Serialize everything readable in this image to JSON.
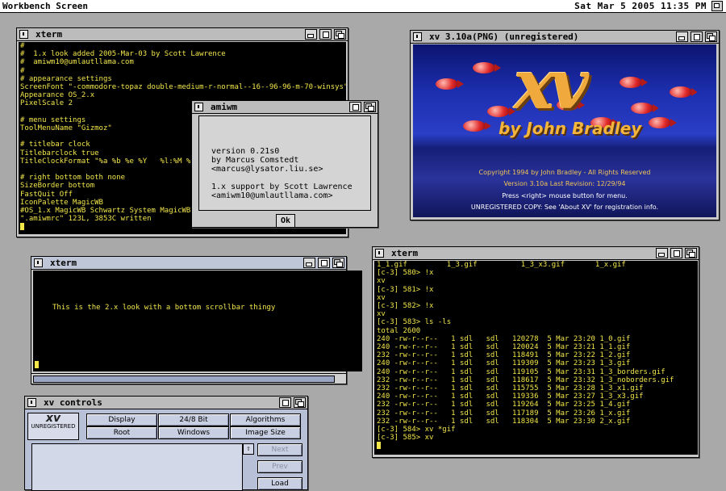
{
  "screen": {
    "title": "Workbench Screen",
    "clock": "Sat Mar  5 2005    11:35 PM"
  },
  "xterm1": {
    "title": "xterm",
    "lines": [
      "#",
      "#  1.x look added 2005-Mar-03 by Scott Lawrence",
      "#  amiwm10@umlautllama.com",
      "#",
      "# appearance settings",
      "ScreenFont \"-commodore-topaz double-medium-r-normal--16--96-96-m-70-winsys\"",
      "Appearance OS_2.x",
      "PixelScale 2",
      "",
      "# menu settings",
      "ToolMenuName \"Gizmoz\"",
      "",
      "# titlebar clock",
      "Titlebarclock true",
      "TitleClockFormat \"%a %b %e %Y   %l:%M %p\"",
      "",
      "# right bottom both none",
      "SizeBorder bottom",
      "FastQuit Off",
      "IconPalette MagicWB",
      "#OS_1.x MagicWB Schwartz System MagicWB",
      "\".amiwmrc\" 123L, 3853C written"
    ]
  },
  "amiwm": {
    "title": "amiwm",
    "text": "version 0.21s0\nby Marcus Comstedt\n<marcus@lysator.liu.se>\n\n1.x support by Scott Lawrence\n<amiwm10@umlautllama.com>",
    "ok_label": "Ok"
  },
  "xv": {
    "title": "xv 3.10a(PNG) (unregistered)",
    "logo": "xv",
    "byline": "by John Bradley",
    "copyright": "Copyright 1994 by John Bradley - All Rights Reserved",
    "version": "Version 3.10a      Last Revision: 12/29/94",
    "press": "Press <right> mouse button for menu.",
    "unregistered": "UNREGISTERED COPY:  See 'About XV' for registration info."
  },
  "xterm2": {
    "title": "xterm",
    "lines": [
      "",
      "",
      "",
      "",
      "This is the 2.x look with a bottom scrollbar thingy"
    ]
  },
  "xterm3": {
    "title": "xterm",
    "lines": [
      "1_1.gif         1_3.gif          1_3_x3.gif       1_x.gif",
      "[c-3] 580> !x",
      "xv",
      "[c-3] 581> !x",
      "xv",
      "[c-3] 582> !x",
      "xv",
      "[c-3] 583> ls -ls",
      "total 2600",
      "240 -rw-r--r--   1 sdl   sdl   120278  5 Mar 23:20 1_0.gif",
      "240 -rw-r--r--   1 sdl   sdl   120024  5 Mar 23:21 1_1.gif",
      "232 -rw-r--r--   1 sdl   sdl   118491  5 Mar 23:22 1_2.gif",
      "240 -rw-r--r--   1 sdl   sdl   119309  5 Mar 23:23 1_3.gif",
      "240 -rw-r--r--   1 sdl   sdl   119105  5 Mar 23:31 1_3_borders.gif",
      "232 -rw-r--r--   1 sdl   sdl   118617  5 Mar 23:32 1_3_noborders.gif",
      "232 -rw-r--r--   1 sdl   sdl   115755  5 Mar 23:28 1_3_x1.gif",
      "240 -rw-r--r--   1 sdl   sdl   119336  5 Mar 23:27 1_3_x3.gif",
      "232 -rw-r--r--   1 sdl   sdl   119264  5 Mar 23:25 1_4.gif",
      "232 -rw-r--r--   1 sdl   sdl   117189  5 Mar 23:26 1_x.gif",
      "232 -rw-r--r--   1 sdl   sdl   118304  5 Mar 23:30 2_x.gif",
      "[c-3] 584> xv *gif",
      "[c-3] 585> xv"
    ]
  },
  "xvcontrols": {
    "title": "xv controls",
    "unregistered": "UNREGISTERED",
    "buttons": [
      "Display",
      "24/8 Bit",
      "Algorithms",
      "Root",
      "Windows",
      "Image Size"
    ],
    "side_buttons": [
      "Next",
      "Prev",
      "Load"
    ]
  }
}
